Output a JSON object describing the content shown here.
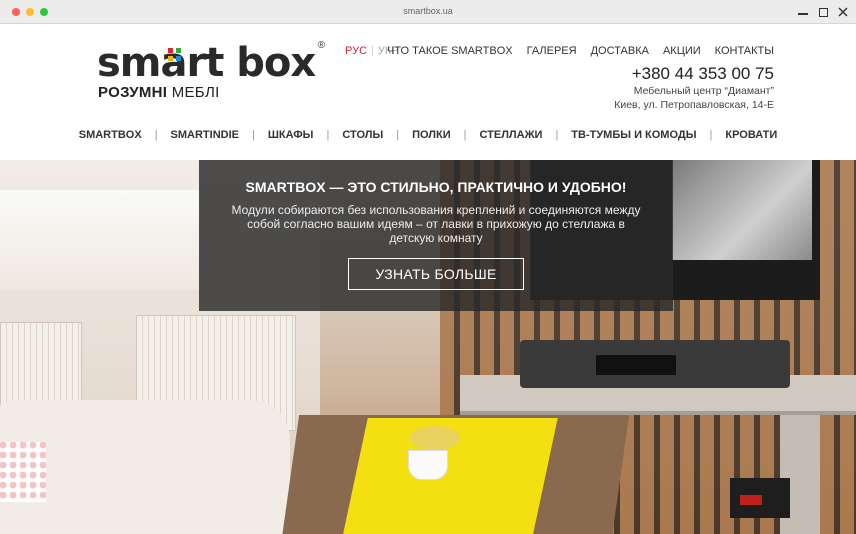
{
  "browser": {
    "url": "smartbox.ua"
  },
  "brand": {
    "logo_text": "smart box",
    "reg_mark": "®",
    "tagline_bold": "РОЗУМНІ",
    "tagline_rest": " МЕБЛІ",
    "accent_red": "#e0203a",
    "accent_green": "#3aa935"
  },
  "lang": {
    "active": "РУС",
    "separator": "|",
    "inactive": "УКР"
  },
  "topnav": [
    "ЧТО ТАКОЕ SMARTBOX",
    "ГАЛЕРЕЯ",
    "ДОСТАВКА",
    "АКЦИИ",
    "КОНТАКТЫ"
  ],
  "contact": {
    "phone": "+380 44 353 00 75",
    "address_line1": "Мебельный центр “Диамант”",
    "address_line2": "Киев, ул. Петропавловская, 14-Е"
  },
  "mainnav": [
    "SMARTBOX",
    "SMARTINDIE",
    "ШКАФЫ",
    "СТОЛЫ",
    "ПОЛКИ",
    "СТЕЛЛАЖИ",
    "ТВ-ТУМБЫ И КОМОДЫ",
    "КРОВАТИ"
  ],
  "mainnav_separator": "|",
  "hero": {
    "title": "SMARTBOX — ЭТО СТИЛЬНО, ПРАКТИЧНО И УДОБНО!",
    "text": "Модули собираются без использования креплений и соединяются между собой согласно вашим идеям – от лавки в прихожую до стеллажа в детскую комнату",
    "button": "УЗНАТЬ БОЛЬШЕ"
  }
}
